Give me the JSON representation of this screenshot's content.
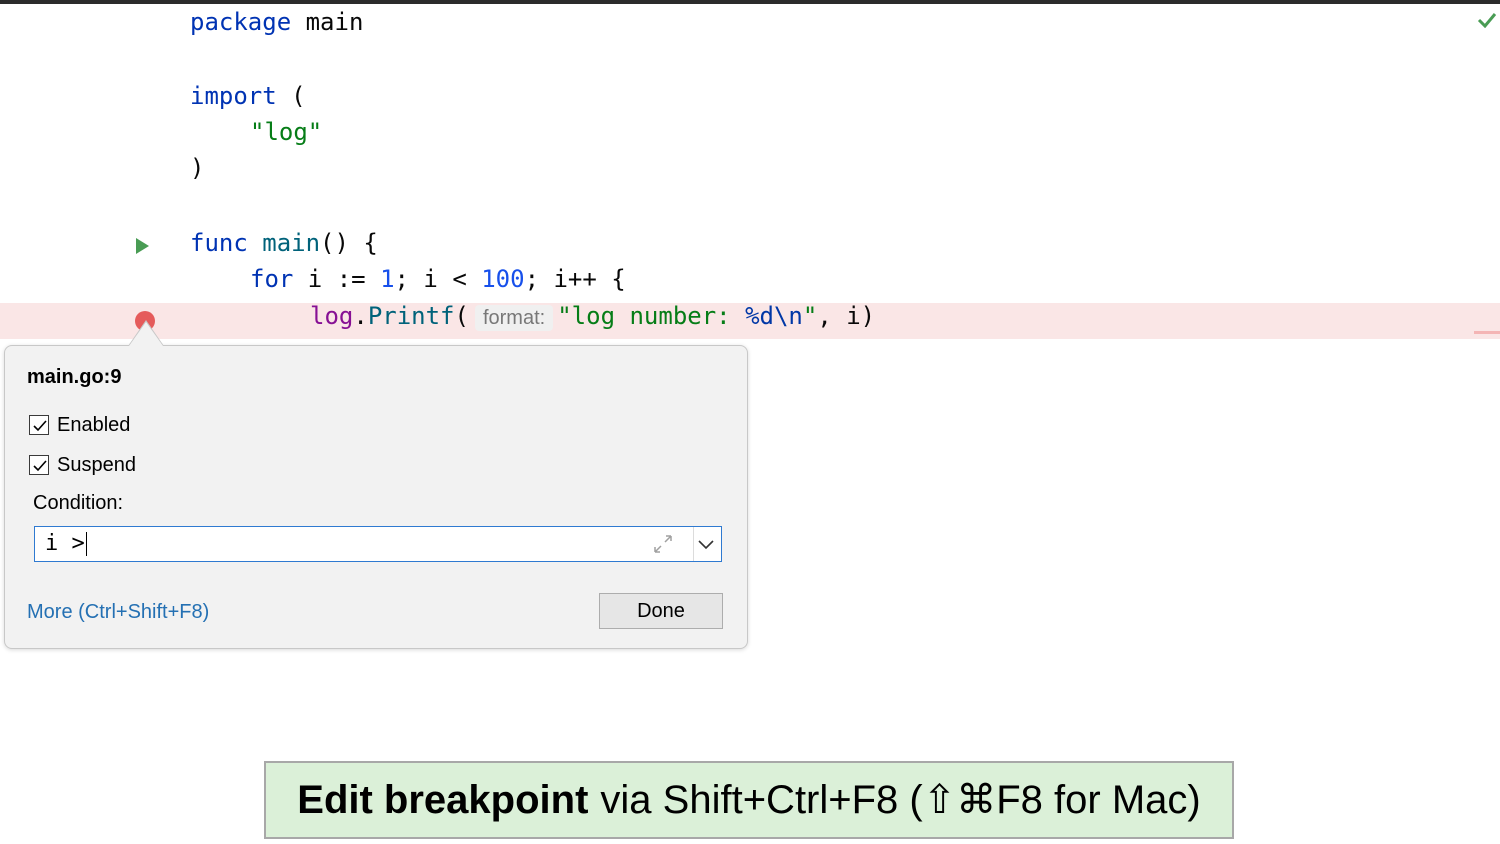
{
  "editor": {
    "lines": {
      "l1": {
        "kw": "package",
        "name": "main"
      },
      "l3": {
        "kw": "import",
        "paren": "("
      },
      "l4": {
        "str": "\"log\""
      },
      "l5": {
        "paren": ")"
      },
      "l7": {
        "kw": "func",
        "fn": "main",
        "rest": "() {"
      },
      "l8": {
        "kw": "for",
        "a": " i := ",
        "n1": "1",
        "b": "; i < ",
        "n2": "100",
        "c": "; i++ {"
      },
      "l9": {
        "pkg": "log",
        "dot": ".",
        "fn": "Printf",
        "open": "(",
        "hint": "format:",
        "str1": "\"log number: ",
        "esc": "%d\\n",
        "str2": "\"",
        "rest": ", i)"
      }
    }
  },
  "popup": {
    "title": "main.go:9",
    "enabled_label": "Enabled",
    "enabled_checked": true,
    "suspend_label": "Suspend",
    "suspend_checked": true,
    "condition_label": "Condition:",
    "condition_value": "i >",
    "more_link": "More (Ctrl+Shift+F8)",
    "done_label": "Done"
  },
  "caption": {
    "bold": "Edit breakpoint",
    "rest": "via Shift+Ctrl+F8 (⇧⌘F8 for Mac)"
  },
  "colors": {
    "breakpoint_line_bg": "#fae6e6",
    "breakpoint_dot": "#e55b5b",
    "caption_bg": "#dbf0d8",
    "link": "#2470b3",
    "focus_border": "#2f7ad1"
  }
}
